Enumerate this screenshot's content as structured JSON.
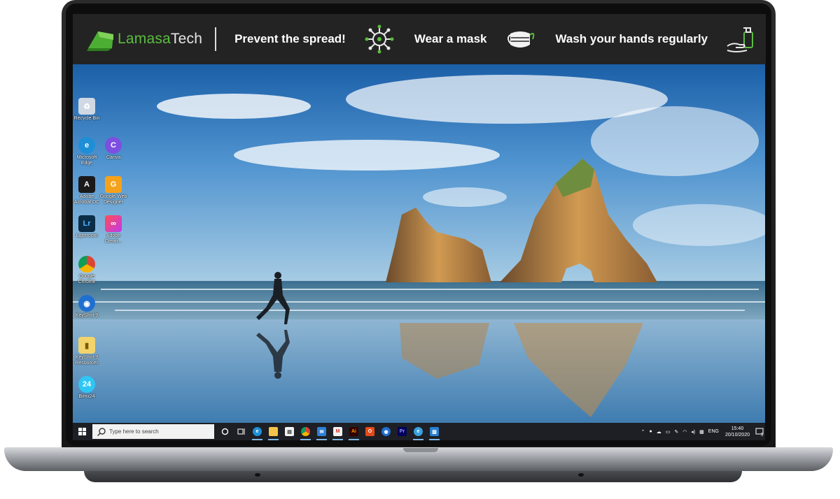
{
  "banner": {
    "logo_text_1": "Lamasa",
    "logo_text_2": "Tech",
    "messages": [
      "Prevent the spread!",
      "Wear a mask",
      "Wash your hands regularly"
    ],
    "accent_color": "#5bbd3f",
    "icons": [
      "virus-icon",
      "face-mask-icon",
      "hand-sanitizer-icon"
    ]
  },
  "desktop": {
    "icons": [
      {
        "label": "Recycle Bin",
        "icon": "recycle-bin-icon"
      },
      {
        "label": "Microsoft Edge",
        "icon": "edge-icon"
      },
      {
        "label": "Canva",
        "icon": "canva-icon"
      },
      {
        "label": "Adobe Acrobat DC",
        "icon": "acrobat-icon"
      },
      {
        "label": "Google Web Designer",
        "icon": "google-web-designer-icon"
      },
      {
        "label": "Lightroom",
        "icon": "lightroom-icon"
      },
      {
        "label": "Adobe Creati...",
        "icon": "creative-cloud-icon"
      },
      {
        "label": "Google Chrome",
        "icon": "chrome-icon"
      },
      {
        "label": "KeyShot 9",
        "icon": "keyshot-icon"
      },
      {
        "label": "KeyShot 9 Resources",
        "icon": "folder-icon"
      },
      {
        "label": "Bitrix24",
        "icon": "bitrix24-icon"
      }
    ]
  },
  "taskbar": {
    "search_placeholder": "Type here to search",
    "pinned": [
      "cortana-icon",
      "task-view-icon",
      "edge-icon",
      "file-explorer-icon",
      "store-icon",
      "chrome-icon",
      "mail-icon",
      "gmail-icon",
      "illustrator-icon",
      "office-icon",
      "keyshot-icon",
      "premiere-icon",
      "edge-beta-icon",
      "photos-icon"
    ],
    "tray": {
      "language": "ENG",
      "time": "15:40",
      "date": "20/10/2020",
      "notification_count": "5"
    }
  }
}
